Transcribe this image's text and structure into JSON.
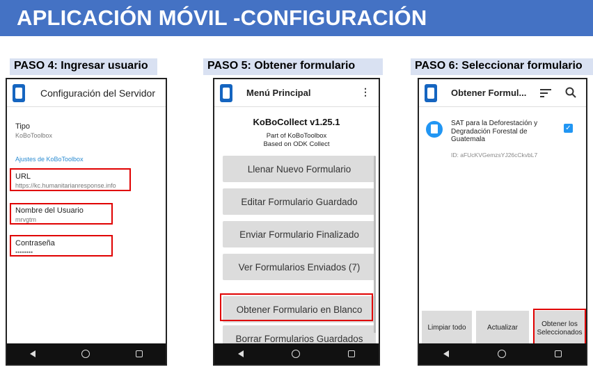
{
  "header": {
    "title": "APLICACIÓN MÓVIL -CONFIGURACIÓN"
  },
  "steps": [
    {
      "label": "PASO 4: Ingresar usuario"
    },
    {
      "label": "PASO 5: Obtener formulario"
    },
    {
      "label": "PASO 6: Seleccionar formulario"
    }
  ],
  "screen1": {
    "title": "Configuración del Servidor",
    "tipo_label": "Tipo",
    "tipo_value": "KoBoToolbox",
    "section": "Ajustes de KoBoToolbox",
    "url_label": "URL",
    "url_value": "https://kc.humanitarianresponse.info",
    "user_label": "Nombre del Usuario",
    "user_value": "mrvgtm",
    "pass_label": "Contraseña",
    "pass_value": "••••••••"
  },
  "screen2": {
    "title": "Menú Principal",
    "app_name": "KoBoCollect v1.25.1",
    "sub1": "Part of KoBoToolbox",
    "sub2": "Based on ODK Collect",
    "buttons": [
      "Llenar Nuevo Formulario",
      "Editar Formulario Guardado",
      "Enviar Formulario Finalizado",
      "Ver Formularios Enviados (7)",
      "Obtener Formulario en Blanco",
      "Borrar Formularios Guardados"
    ]
  },
  "screen3": {
    "title": "Obtener Formul...",
    "form_title": "SAT para la Deforestación y Degradación Forestal de Guatemala",
    "form_id": "ID: aFUcKVGemzsYJ26cCkvbL7",
    "btn_clear": "Limpiar todo",
    "btn_refresh": "Actualizar",
    "btn_get": "Obtener los Seleccionados"
  },
  "colors": {
    "banner": "#4472c4",
    "step_bg": "#d9e1f2",
    "highlight": "#e00000",
    "brand": "#1565c0"
  }
}
